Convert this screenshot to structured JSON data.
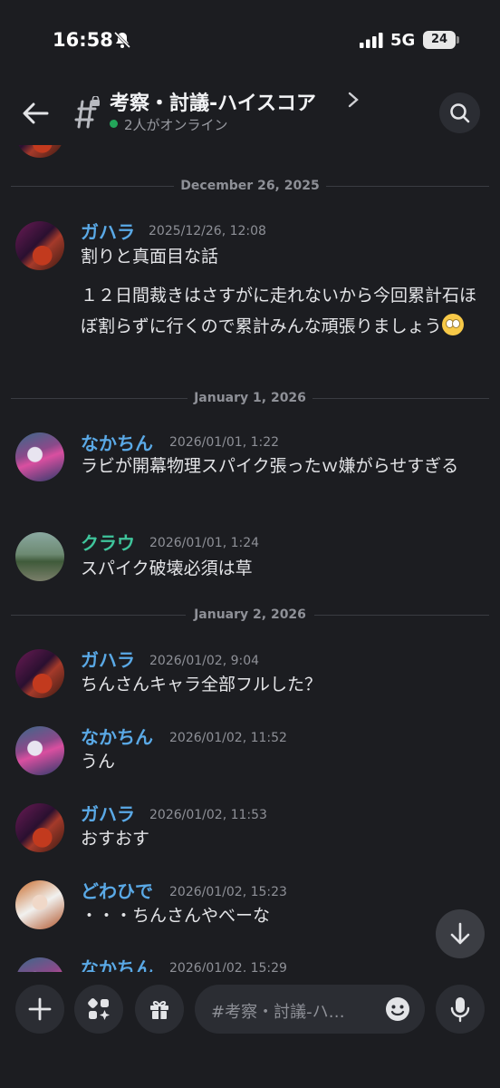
{
  "status_bar": {
    "time": "16:58",
    "network": "5G",
    "battery": "24"
  },
  "header": {
    "channel_title": "考察・討議-ハイスコア",
    "online_status": "2人がオンライン"
  },
  "feed": {
    "dividers": [
      "December 26, 2025",
      "January 1, 2026",
      "January 2, 2026"
    ],
    "messages": [
      {
        "username": "ガハラ",
        "timestamp": "2025/12/26, 12:08",
        "lines": [
          "割りと真面目な話",
          "１２日間裁きはさすがに走れないから今回累計石ほぼ割らずに行くので累計みんな頑張りましょう"
        ],
        "emoji": "eye-roll-emoji"
      },
      {
        "username": "なかちん",
        "timestamp": "2026/01/01, 1:22",
        "lines": [
          "ラビが開幕物理スパイク張ったｗ嫌がらせすぎる"
        ]
      },
      {
        "username": "クラウ",
        "timestamp": "2026/01/01, 1:24",
        "lines": [
          "スパイク破壊必須は草"
        ]
      },
      {
        "username": "ガハラ",
        "timestamp": "2026/01/02, 9:04",
        "lines": [
          "ちんさんキャラ全部フルした？"
        ]
      },
      {
        "username": "なかちん",
        "timestamp": "2026/01/02, 11:52",
        "lines": [
          "うん"
        ]
      },
      {
        "username": "ガハラ",
        "timestamp": "2026/01/02, 11:53",
        "lines": [
          "おすおす"
        ]
      },
      {
        "username": "どわひで",
        "timestamp": "2026/01/02, 15:23",
        "lines": [
          "・・・ちんさんやべーな"
        ]
      },
      {
        "username": "なかちん",
        "timestamp": "2026/01/02, 15:29",
        "lines": []
      }
    ]
  },
  "composer": {
    "placeholder": "#考察・討議-ハ…"
  },
  "colors": {
    "background": "#1c1d21",
    "username_blue": "#5aa9e6",
    "username_green": "#3fc49b",
    "online": "#23a55a"
  }
}
